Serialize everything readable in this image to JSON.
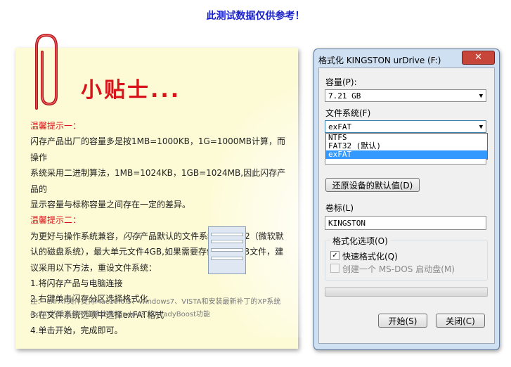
{
  "banner": "此测试数据仅供参考！",
  "note": {
    "title": "小贴士...",
    "tip1_heading": "温馨提示一：",
    "tip1_lines": [
      "闪存产品出厂的容量多是按1MB=1000KB，1G=1000MB计算，而操作",
      "系统采用二进制算法，1MB=1024KB，1GB=1024MB,因此闪存产品的",
      "显示容量与标称容量之间存在一定的差异。"
    ],
    "tip2_heading": "温馨提示二：",
    "tip2_line1_a": "为更好与操作系统兼容，",
    "tip2_line1_b": "闪存",
    "tip2_line1_c": "产品默认的文件系统为FTA32（微软默",
    "tip2_lines": [
      "认的磁盘系统），最大单元文件4GB,如果需要存储超过4GB文件，建",
      "议采用以下方法，重设文件系统：",
      "1.将闪存产品与电脑连接",
      "2.右键单击闪存分区选择格式化",
      "3.在文件系统选项中选择exFAT格式",
      "4.单击开始，完成即可。"
    ],
    "footnote_lines": [
      "注：   exFAT文件支持Mac10.6.5、Windows7、VISTA和安装最新补丁的XP系统",
      "           exFAT的设备将不能够使用Windows  的ReadyBoost功能"
    ]
  },
  "dialog": {
    "title": "格式化 KINGSTON urDrive (F:)",
    "close": "✕",
    "capacity_label": "容量(P):",
    "capacity_value": "7.21 GB",
    "fs_label": "文件系统(F)",
    "fs_value": "exFAT",
    "fs_options": [
      "NTFS",
      "FAT32 (默认)",
      "exFAT"
    ],
    "restore_button": "还原设备的默认值(D)",
    "volume_label": "卷标(L)",
    "volume_value": "KINGSTON",
    "format_options_label": "格式化选项(O)",
    "quick_format": "快速格式化(Q)",
    "quick_format_checked": true,
    "msdos_disk": "创建一个 MS-DOS 启动盘(M)",
    "start_button": "开始(S)",
    "close_button": "关闭(C)"
  }
}
